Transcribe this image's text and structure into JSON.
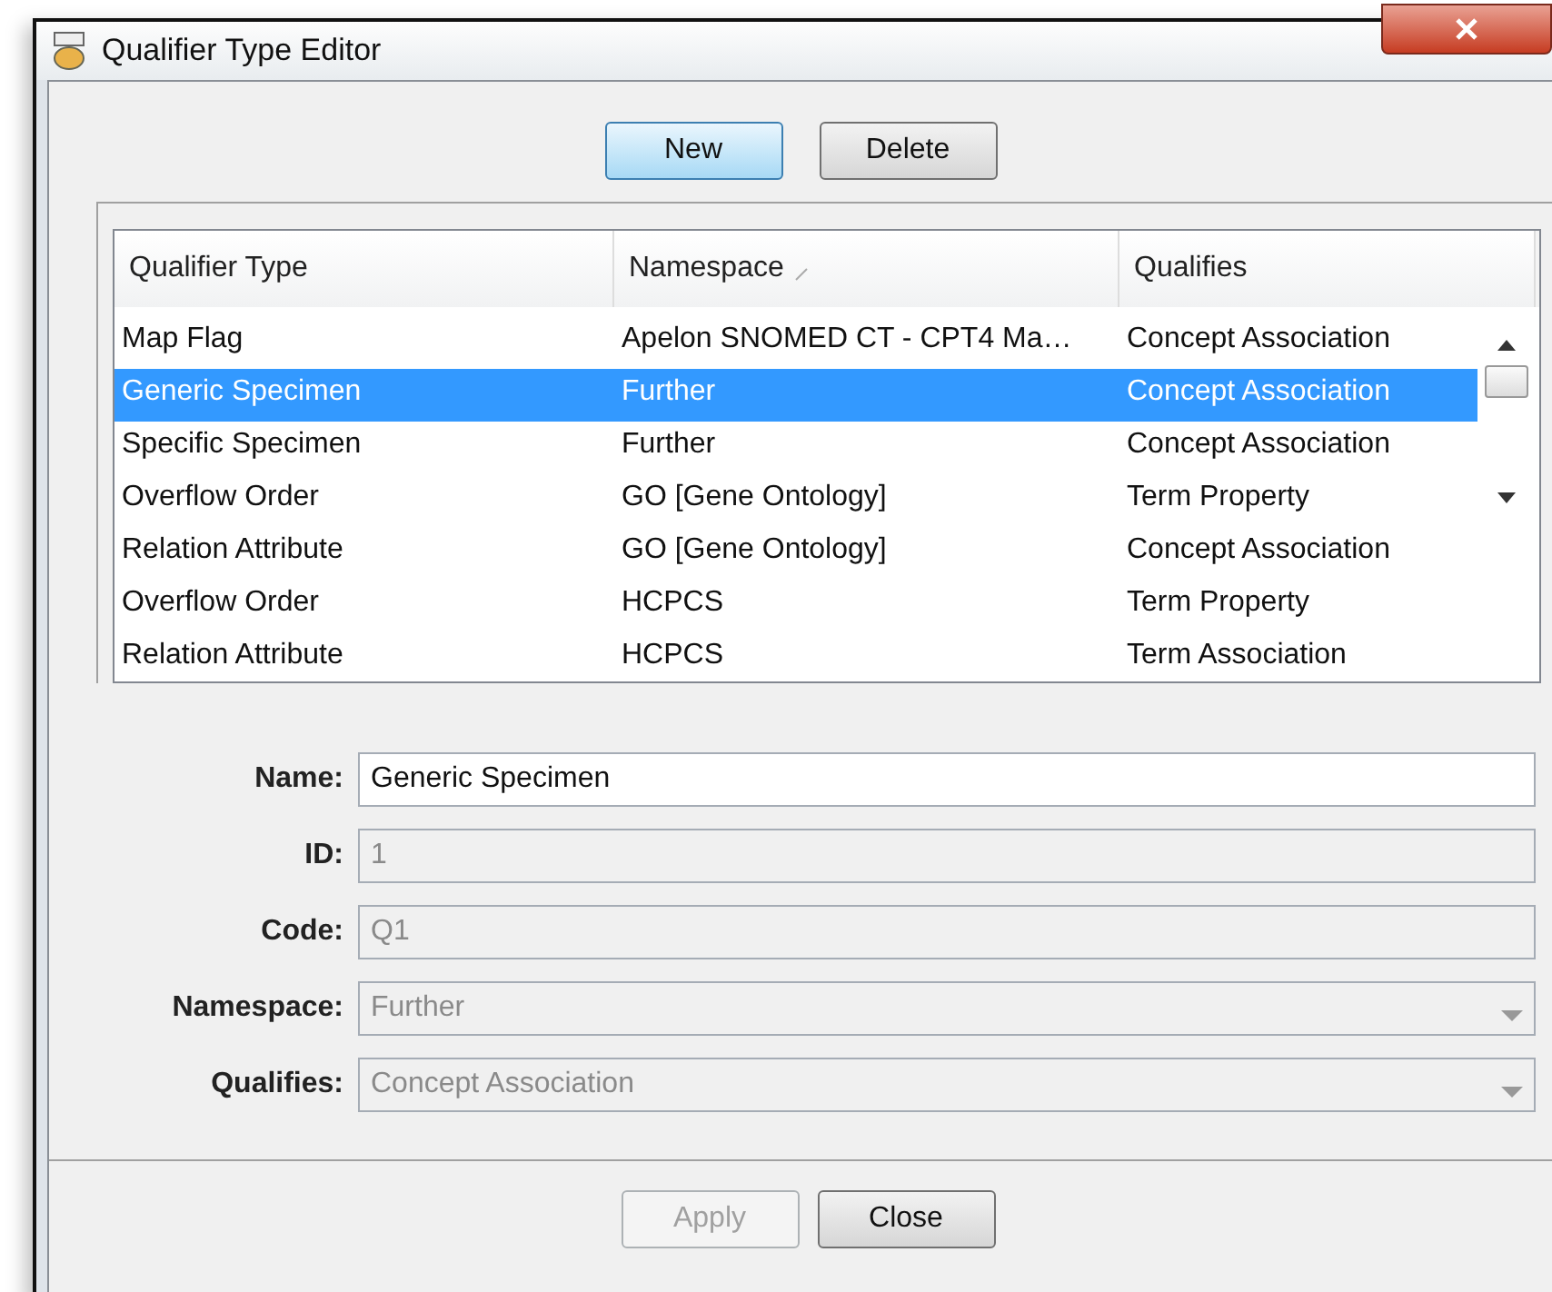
{
  "window": {
    "title": "Qualifier Type Editor"
  },
  "toolbar": [
    {
      "label": "New",
      "default": true,
      "disabled": false
    },
    {
      "label": "Delete",
      "default": false,
      "disabled": false
    }
  ],
  "table": {
    "columns": [
      {
        "label": "Qualifier Type",
        "sorted": false
      },
      {
        "label": "Namespace",
        "sorted": true
      },
      {
        "label": "Qualifies",
        "sorted": false
      }
    ],
    "rows": [
      {
        "cells": [
          "Map Flag",
          "Apelon SNOMED CT - CPT4 Ma…",
          "Concept Association"
        ],
        "selected": false
      },
      {
        "cells": [
          "Generic Specimen",
          "Further",
          "Concept Association"
        ],
        "selected": true
      },
      {
        "cells": [
          "Specific Specimen",
          "Further",
          "Concept Association"
        ],
        "selected": false
      },
      {
        "cells": [
          "Overflow Order",
          "GO [Gene Ontology]",
          "Term Property"
        ],
        "selected": false
      },
      {
        "cells": [
          "Relation Attribute",
          "GO [Gene Ontology]",
          "Concept Association"
        ],
        "selected": false
      },
      {
        "cells": [
          "Overflow Order",
          "HCPCS",
          "Term Property"
        ],
        "selected": false
      },
      {
        "cells": [
          "Relation Attribute",
          "HCPCS",
          "Term Association"
        ],
        "selected": false
      }
    ]
  },
  "form": [
    {
      "label": "Name:",
      "value": "Generic Specimen",
      "kind": "text",
      "disabled": false
    },
    {
      "label": "ID:",
      "value": "1",
      "kind": "text",
      "disabled": true
    },
    {
      "label": "Code:",
      "value": "Q1",
      "kind": "text",
      "disabled": true
    },
    {
      "label": "Namespace:",
      "value": "Further",
      "kind": "combo",
      "disabled": true
    },
    {
      "label": "Qualifies:",
      "value": "Concept Association",
      "kind": "combo",
      "disabled": true
    }
  ],
  "footer": [
    {
      "label": "Apply",
      "default": false,
      "disabled": true
    },
    {
      "label": "Close",
      "default": false,
      "disabled": false
    }
  ]
}
